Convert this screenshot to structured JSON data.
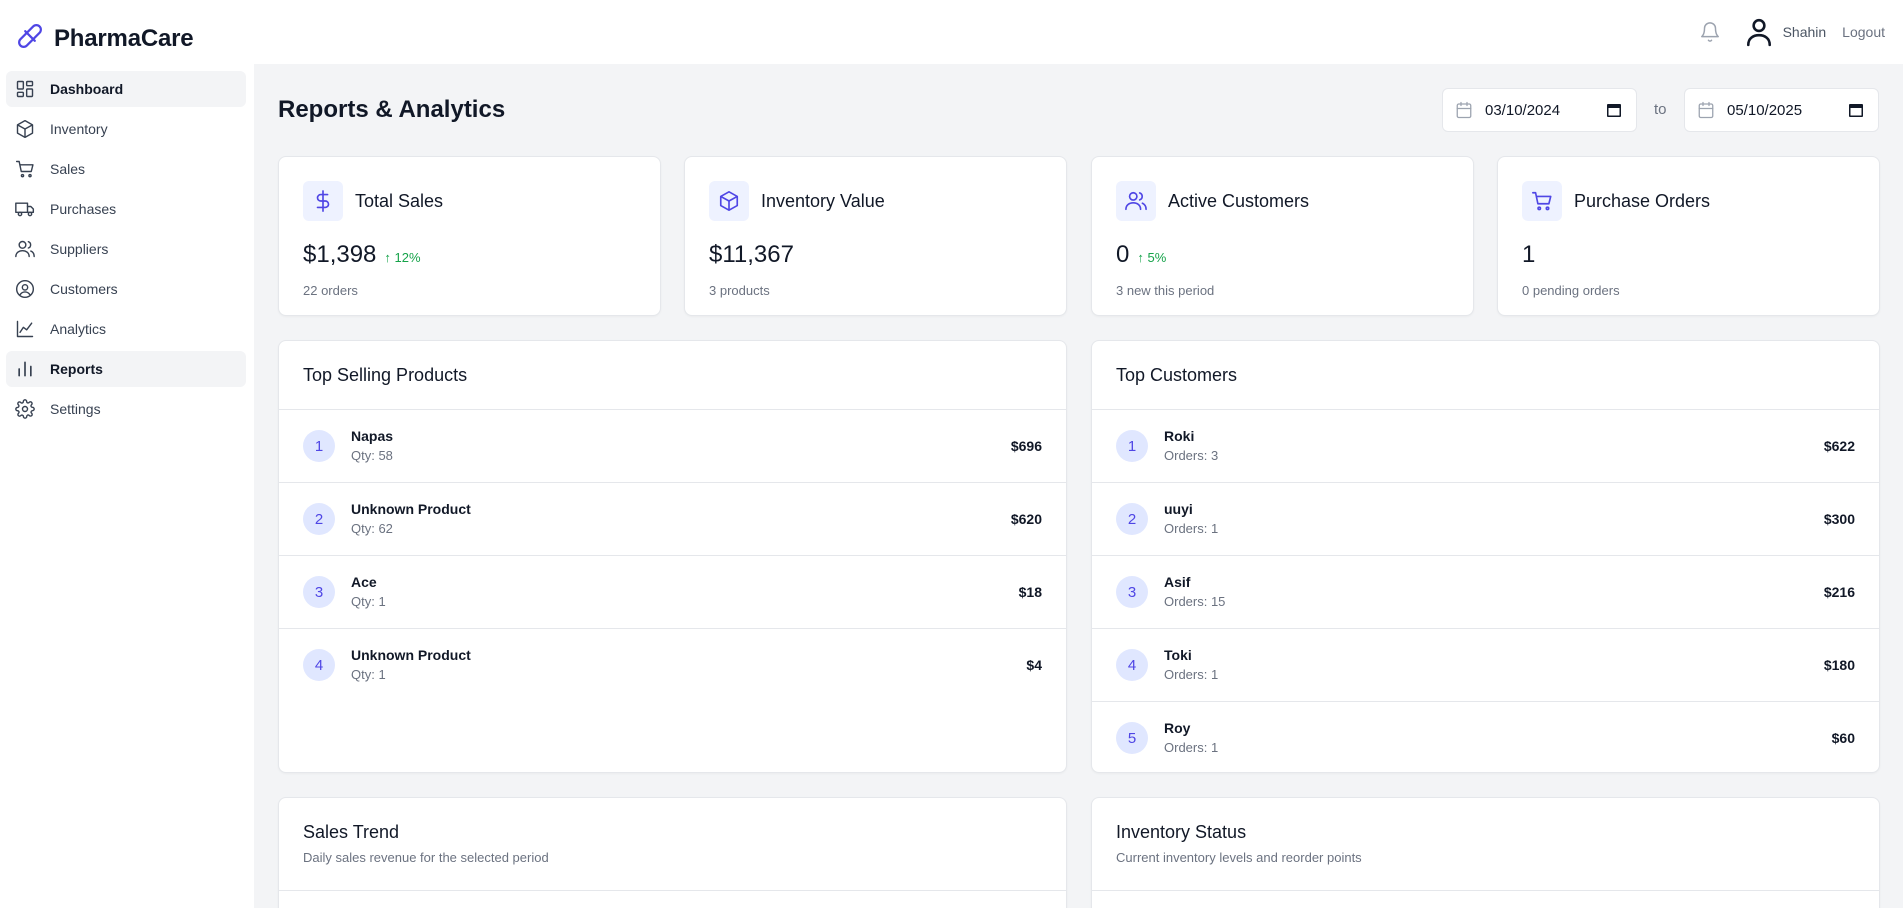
{
  "app": {
    "name": "PharmaCare"
  },
  "header": {
    "user_name": "Shahin",
    "logout_label": "Logout"
  },
  "sidebar": {
    "items": [
      {
        "label": "Dashboard",
        "icon": "dashboard-icon",
        "active": true
      },
      {
        "label": "Inventory",
        "icon": "box-icon"
      },
      {
        "label": "Sales",
        "icon": "cart-icon"
      },
      {
        "label": "Purchases",
        "icon": "truck-icon"
      },
      {
        "label": "Suppliers",
        "icon": "users-icon"
      },
      {
        "label": "Customers",
        "icon": "user-circle-icon"
      },
      {
        "label": "Analytics",
        "icon": "line-chart-icon"
      },
      {
        "label": "Reports",
        "icon": "bar-chart-icon",
        "active": true
      },
      {
        "label": "Settings",
        "icon": "gear-icon"
      }
    ]
  },
  "page": {
    "title": "Reports & Analytics",
    "date_from": "03/10/2024",
    "date_to": "05/10/2025",
    "to_label": "to"
  },
  "stats": [
    {
      "title": "Total Sales",
      "value": "$1,398",
      "change": "↑ 12%",
      "sub": "22 orders",
      "icon": "dollar-icon"
    },
    {
      "title": "Inventory Value",
      "value": "$11,367",
      "change": "",
      "sub": "3 products",
      "icon": "box-icon"
    },
    {
      "title": "Active Customers",
      "value": "0",
      "change": "↑ 5%",
      "sub": "3 new this period",
      "icon": "users-icon"
    },
    {
      "title": "Purchase Orders",
      "value": "1",
      "change": "",
      "sub": "0 pending orders",
      "icon": "cart-icon"
    }
  ],
  "top_products": {
    "title": "Top Selling Products",
    "rows": [
      {
        "rank": "1",
        "name": "Napas",
        "sub": "Qty: 58",
        "amount": "$696"
      },
      {
        "rank": "2",
        "name": "Unknown Product",
        "sub": "Qty: 62",
        "amount": "$620"
      },
      {
        "rank": "3",
        "name": "Ace",
        "sub": "Qty: 1",
        "amount": "$18"
      },
      {
        "rank": "4",
        "name": "Unknown Product",
        "sub": "Qty: 1",
        "amount": "$4"
      }
    ]
  },
  "top_customers": {
    "title": "Top Customers",
    "rows": [
      {
        "rank": "1",
        "name": "Roki",
        "sub": "Orders: 3",
        "amount": "$622"
      },
      {
        "rank": "2",
        "name": "uuyi",
        "sub": "Orders: 1",
        "amount": "$300"
      },
      {
        "rank": "3",
        "name": "Asif",
        "sub": "Orders: 15",
        "amount": "$216"
      },
      {
        "rank": "4",
        "name": "Toki",
        "sub": "Orders: 1",
        "amount": "$180"
      },
      {
        "rank": "5",
        "name": "Roy",
        "sub": "Orders: 1",
        "amount": "$60"
      }
    ]
  },
  "sales_trend": {
    "title": "Sales Trend",
    "subtitle": "Daily sales revenue for the selected period"
  },
  "inventory_status": {
    "title": "Inventory Status",
    "subtitle": "Current inventory levels and reorder points"
  },
  "colors": {
    "accent": "#4f46e5",
    "accent_bg": "#eef2ff",
    "positive": "#16a34a"
  }
}
